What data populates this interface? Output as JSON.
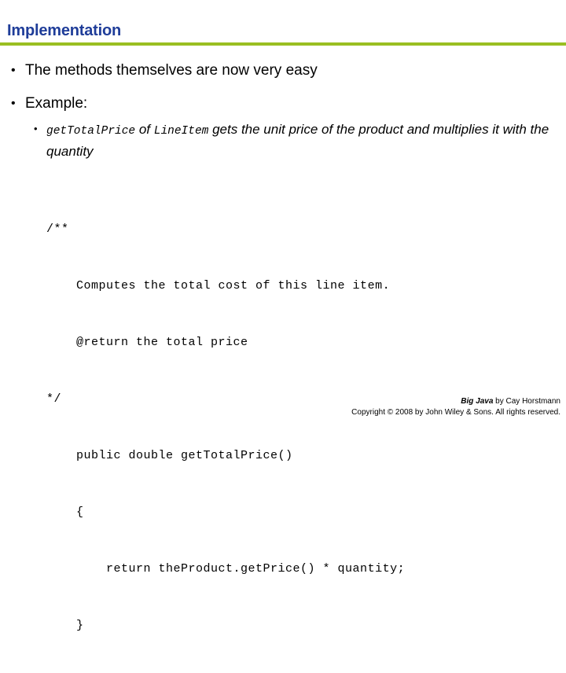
{
  "slide": {
    "title": "Implementation",
    "title_color": "#1F3D99",
    "rule_color": "#9ABF22",
    "background_color": "#FFFFFF"
  },
  "bullets": [
    {
      "marker": "•",
      "text": "The methods themselves are now very easy"
    },
    {
      "marker": "•",
      "text": "Example:"
    }
  ],
  "sub_bullet": {
    "marker": "•",
    "segment_1_code": "getTotalPrice",
    "segment_2_text": " of ",
    "segment_3_code": "LineItem",
    "segment_4_text": " gets the unit price of the product and multiplies it with the quantity"
  },
  "code": {
    "lines": [
      "/**",
      "    Computes the total cost of this line item.",
      "    @return the total price",
      "*/",
      "    public double getTotalPrice()",
      "    {",
      "        return theProduct.getPrice() * quantity;",
      "    }"
    ]
  },
  "footer": {
    "book_title": "Big Java",
    "byline": " by Cay Horstmann",
    "copyright": "Copyright © 2008 by John Wiley & Sons.  All rights reserved."
  }
}
